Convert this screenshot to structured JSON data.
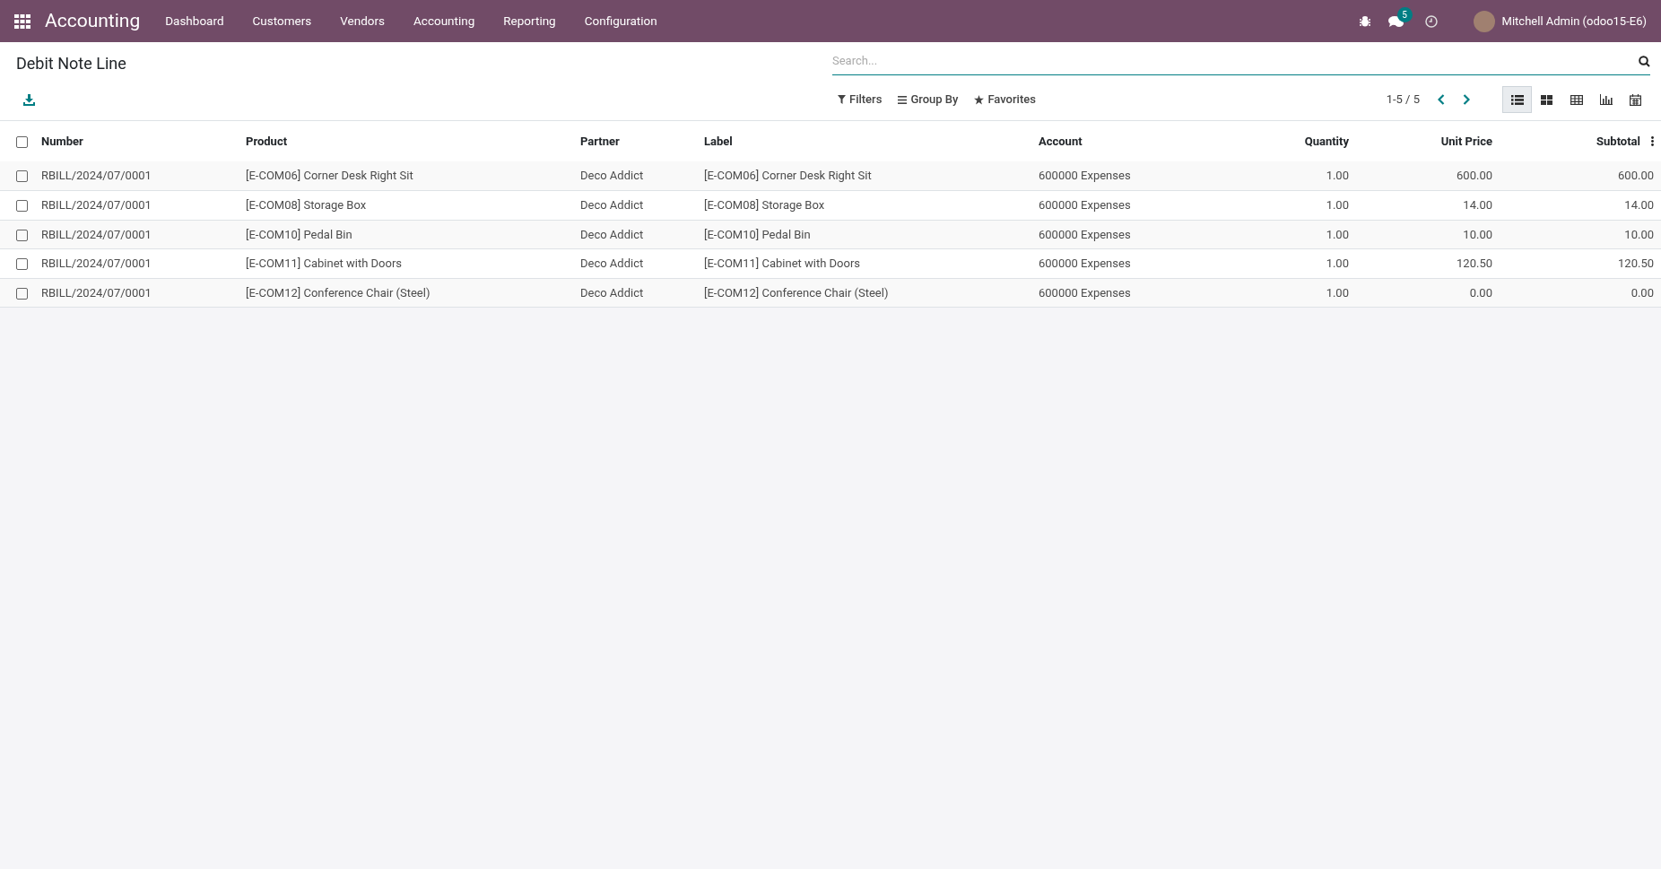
{
  "navbar": {
    "app_title": "Accounting",
    "menu": [
      "Dashboard",
      "Customers",
      "Vendors",
      "Accounting",
      "Reporting",
      "Configuration"
    ],
    "message_count": "5",
    "user": "Mitchell Admin (odoo15-E6)"
  },
  "control_panel": {
    "title": "Debit Note Line",
    "search": {
      "placeholder": "Search..."
    },
    "filters": [
      "Filters",
      "Group By",
      "Favorites"
    ],
    "pager": "1-5 / 5",
    "views": [
      {
        "kind": "list",
        "selected": true
      },
      {
        "kind": "kanban",
        "selected": false
      },
      {
        "kind": "pivot",
        "selected": false
      },
      {
        "kind": "graph",
        "selected": false
      },
      {
        "kind": "calendar",
        "selected": false
      }
    ]
  },
  "table": {
    "select_all": {
      "checked": false
    },
    "columns": [
      {
        "label": "Number",
        "kind": "text"
      },
      {
        "label": "Product",
        "kind": "text"
      },
      {
        "label": "Partner",
        "kind": "text"
      },
      {
        "label": "Label",
        "kind": "text"
      },
      {
        "label": "Account",
        "kind": "text"
      },
      {
        "label": "Quantity",
        "kind": "numeric"
      },
      {
        "label": "Unit Price",
        "kind": "numeric"
      },
      {
        "label": "Subtotal",
        "kind": "numeric"
      }
    ],
    "rows": [
      {
        "selected": false,
        "cells": [
          "RBILL/2024/07/0001",
          "[E-COM06] Corner Desk Right Sit",
          "Deco Addict",
          "[E-COM06] Corner Desk Right Sit",
          "600000 Expenses",
          "1.00",
          "600.00",
          "600.00"
        ]
      },
      {
        "selected": false,
        "cells": [
          "RBILL/2024/07/0001",
          "[E-COM08] Storage Box",
          "Deco Addict",
          "[E-COM08] Storage Box",
          "600000 Expenses",
          "1.00",
          "14.00",
          "14.00"
        ]
      },
      {
        "selected": false,
        "cells": [
          "RBILL/2024/07/0001",
          "[E-COM10] Pedal Bin",
          "Deco Addict",
          "[E-COM10] Pedal Bin",
          "600000 Expenses",
          "1.00",
          "10.00",
          "10.00"
        ]
      },
      {
        "selected": false,
        "cells": [
          "RBILL/2024/07/0001",
          "[E-COM11] Cabinet with Doors",
          "Deco Addict",
          "[E-COM11] Cabinet with Doors",
          "600000 Expenses",
          "1.00",
          "120.50",
          "120.50"
        ]
      },
      {
        "selected": false,
        "cells": [
          "RBILL/2024/07/0001",
          "[E-COM12] Conference Chair (Steel)",
          "Deco Addict",
          "[E-COM12] Conference Chair (Steel)",
          "600000 Expenses",
          "1.00",
          "0.00",
          "0.00"
        ]
      }
    ]
  }
}
